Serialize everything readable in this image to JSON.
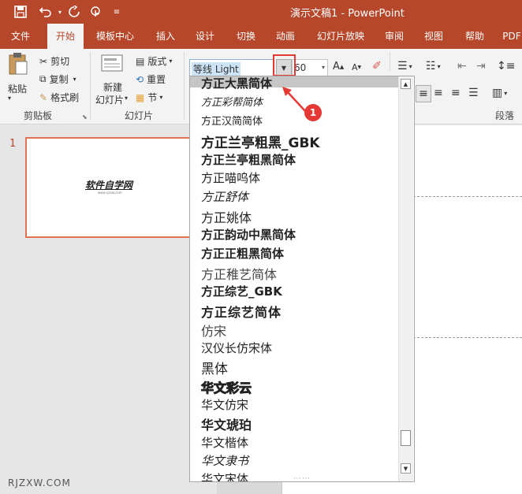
{
  "app": {
    "title": "演示文稿1  -  PowerPoint",
    "quick_access": [
      "save-icon",
      "undo-icon",
      "redo-icon",
      "touch-mode-icon",
      "customize-icon"
    ]
  },
  "tabs": [
    "文件",
    "开始",
    "模板中心",
    "插入",
    "设计",
    "切换",
    "动画",
    "幻灯片放映",
    "审阅",
    "视图",
    "帮助",
    "PDF"
  ],
  "active_tab": "开始",
  "ribbon": {
    "clipboard": {
      "paste": "粘贴",
      "cut": "剪切",
      "copy": "复制",
      "format_painter": "格式刷",
      "group_label": "剪贴板"
    },
    "slides": {
      "new_slide_line1": "新建",
      "new_slide_line2": "幻灯片",
      "layout": "版式",
      "reset": "重置",
      "section": "节",
      "group_label": "幻灯片"
    },
    "font": {
      "font_name_value": "等线 Light",
      "font_size_value": "60"
    },
    "paragraph": {
      "group_label": "段落"
    }
  },
  "slide_panel": {
    "slide_number": "1",
    "thumbnail_title": "软件自学网",
    "thumbnail_subtitle": "www.rjzxw.com"
  },
  "font_list": [
    "方正大黑简体",
    "方正彩帮简体",
    "方正汉简简体",
    "方正兰亭粗黑_GBK",
    "方正兰亭粗黑简体",
    "方正喵呜体",
    "方正舒体",
    "方正姚体",
    "方正韵动中黑简体",
    "方正正粗黑简体",
    "方正稚艺简体",
    "方正综艺_GBK",
    "方正综艺简体",
    "仿宋",
    "汉仪长仿宋体",
    "黑体",
    "华文彩云",
    "华文仿宋",
    "华文琥珀",
    "华文楷体",
    "华文隶书",
    "华文宋体"
  ],
  "annotation": {
    "badge_number": "1"
  },
  "watermark": "RJZXW.COM",
  "colors": {
    "brand": "#b7472a",
    "highlight_box": "#e53935",
    "thumbnail_border": "#e07454"
  }
}
